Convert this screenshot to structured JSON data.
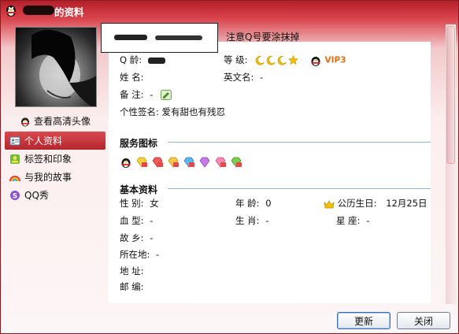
{
  "window": {
    "title": "的资料"
  },
  "nickname_note": "注意Q号要涂抹掉",
  "sidebar": {
    "hd_avatar_label": "查看高清头像",
    "items": [
      {
        "label": "个人资料",
        "icon": "profile-card-icon"
      },
      {
        "label": "标签和印象",
        "icon": "tag-icon"
      },
      {
        "label": "与我的故事",
        "icon": "rainbow-icon"
      },
      {
        "label": "QQ秀",
        "icon": "qq-show-icon"
      }
    ]
  },
  "profile": {
    "qq_label": "Q  龄:",
    "level_label": "等  级:",
    "vip_label": "VIP3",
    "name_label": "姓  名:",
    "english_name_label": "英文名:",
    "english_name_value": "-",
    "remark_label": "备  注:",
    "remark_value": "-",
    "signature_label": "个性签名:",
    "signature_value": "爱有甜也有残忍"
  },
  "services": {
    "title": "服务图标",
    "icon_count": 8
  },
  "basic": {
    "title": "基本资料",
    "gender_label": "性  别:",
    "gender_value": "女",
    "age_label": "年  龄:",
    "age_value": "0",
    "birthday_label": "公历生日:",
    "birthday_value": "12月25日",
    "blood_label": "血  型:",
    "blood_value": "-",
    "zodiac_label": "生  肖:",
    "zodiac_value": "-",
    "constellation_label": "星    座:",
    "constellation_value": "-",
    "hometown_label": "故  乡:",
    "hometown_value": "-",
    "location_label": "所在地:",
    "location_value": "-",
    "address_label": "地  址:",
    "postcode_label": "邮  编:"
  },
  "buttons": {
    "refresh": "更新",
    "close": "关闭"
  },
  "colors": {
    "title_bar": "#b3202a",
    "active_item": "#c2343a",
    "section_line": "#8fb4d6",
    "vip": "#e07010"
  }
}
